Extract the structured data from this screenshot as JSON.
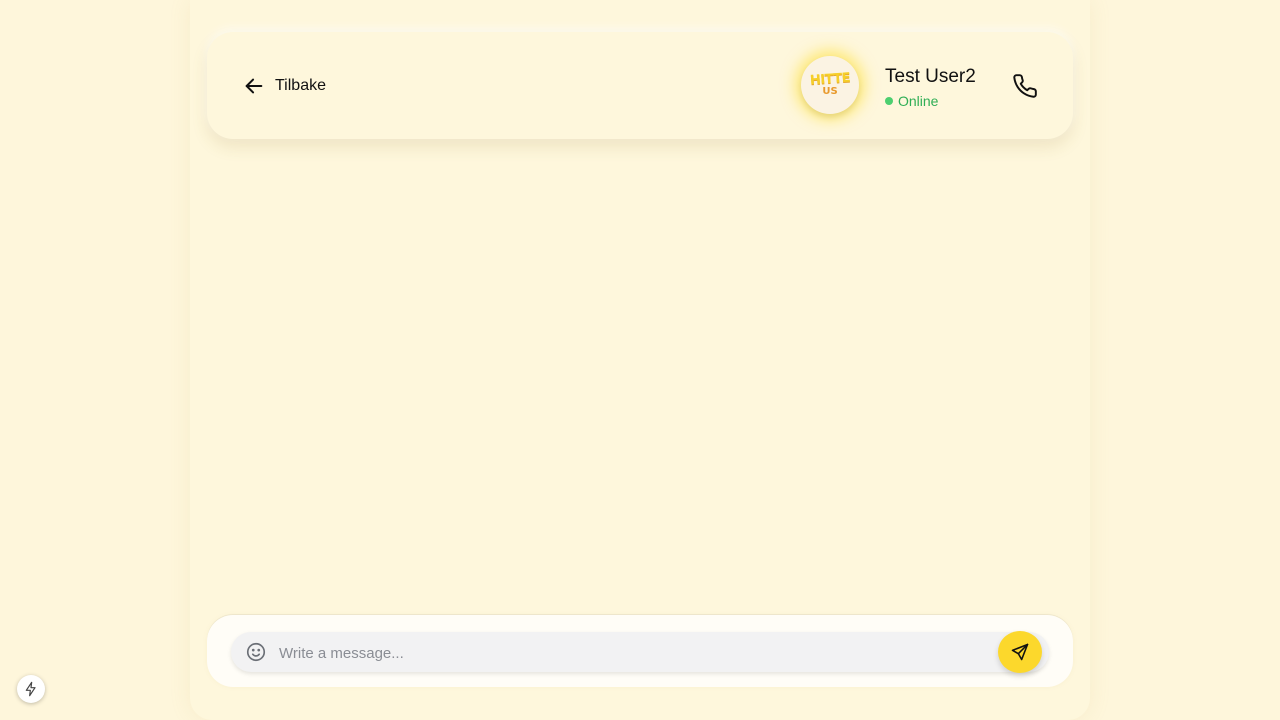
{
  "header": {
    "back_label": "Tilbake",
    "contact": {
      "name": "Test User2",
      "status": "Online",
      "avatar_logo_line1": "HITTE",
      "avatar_logo_line2": "US"
    },
    "call_icon": "phone-icon"
  },
  "composer": {
    "placeholder": "Write a message...",
    "value": "",
    "emoji_icon": "smiley-icon",
    "send_icon": "send-icon"
  },
  "floating": {
    "badge_icon": "lightning-bolt-icon"
  },
  "colors": {
    "page_background": "#fef6db",
    "accent_yellow": "#fcd82c",
    "online_green": "#2fae55",
    "input_background": "#f2f2f3"
  }
}
